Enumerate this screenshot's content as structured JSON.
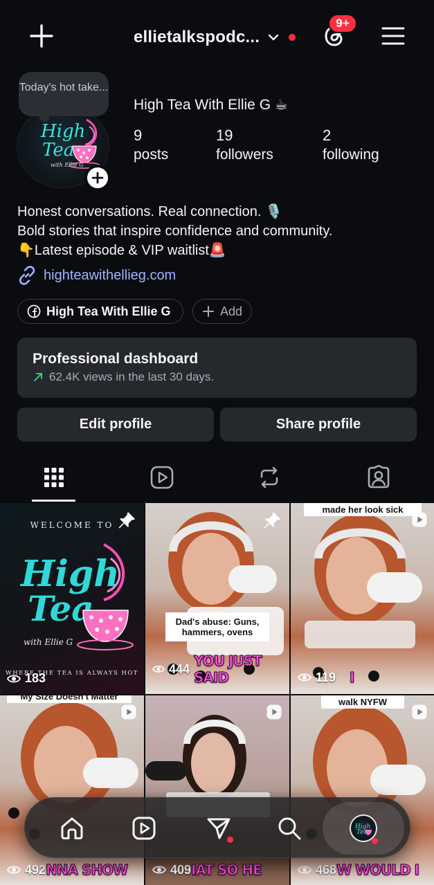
{
  "header": {
    "username": "ellietalkspodc...",
    "notification_badge": "9+"
  },
  "profile": {
    "note": "Today's hot take...",
    "display_name": "High Tea With Ellie G ☕",
    "stats": [
      {
        "value": "9",
        "label": "posts"
      },
      {
        "value": "19",
        "label": "followers"
      },
      {
        "value": "2",
        "label": "following"
      }
    ],
    "bio": [
      "Honest conversations. Real connection. 🎙️",
      "Bold stories that inspire confidence and community.",
      "👇Latest episode & VIP waitlist🚨"
    ],
    "link": "highteawithellieg.com",
    "chips": {
      "facebook": "High Tea With Ellie G",
      "add": "Add"
    }
  },
  "dashboard": {
    "title": "Professional dashboard",
    "subtitle": "62.4K views in the last 30 days."
  },
  "buttons": {
    "edit": "Edit profile",
    "share": "Share profile"
  },
  "posts": [
    {
      "views": "183",
      "top_text": "",
      "middle_text": "",
      "caption": "",
      "logo_welcome": "WELCOME TO",
      "logo_title_1": "High",
      "logo_title_2": "Tea",
      "logo_sub": "with Ellie G",
      "logo_footer": "WHERE THE TEA IS ALWAYS HOT"
    },
    {
      "views": "444",
      "top_text": "",
      "middle_text": "Dad's abuse: Guns, hammers, ovens",
      "caption": "YOU JUST SAID"
    },
    {
      "views": "119",
      "top_text": "made her look sick",
      "middle_text": "",
      "caption": "I"
    },
    {
      "views": "492",
      "top_text": "My Size Doesn't Matter",
      "middle_text": "",
      "caption": "NNA SHOW"
    },
    {
      "views": "409",
      "top_text": "",
      "middle_text": "",
      "caption": "IAT SO HE"
    },
    {
      "views": "468",
      "top_text": "walk NYFW",
      "middle_text": "",
      "caption": "W WOULD I"
    }
  ],
  "colors": {
    "background": "#0b0c10",
    "card": "#25292e",
    "link": "#a0b5ff",
    "badge": "#ff3040"
  }
}
